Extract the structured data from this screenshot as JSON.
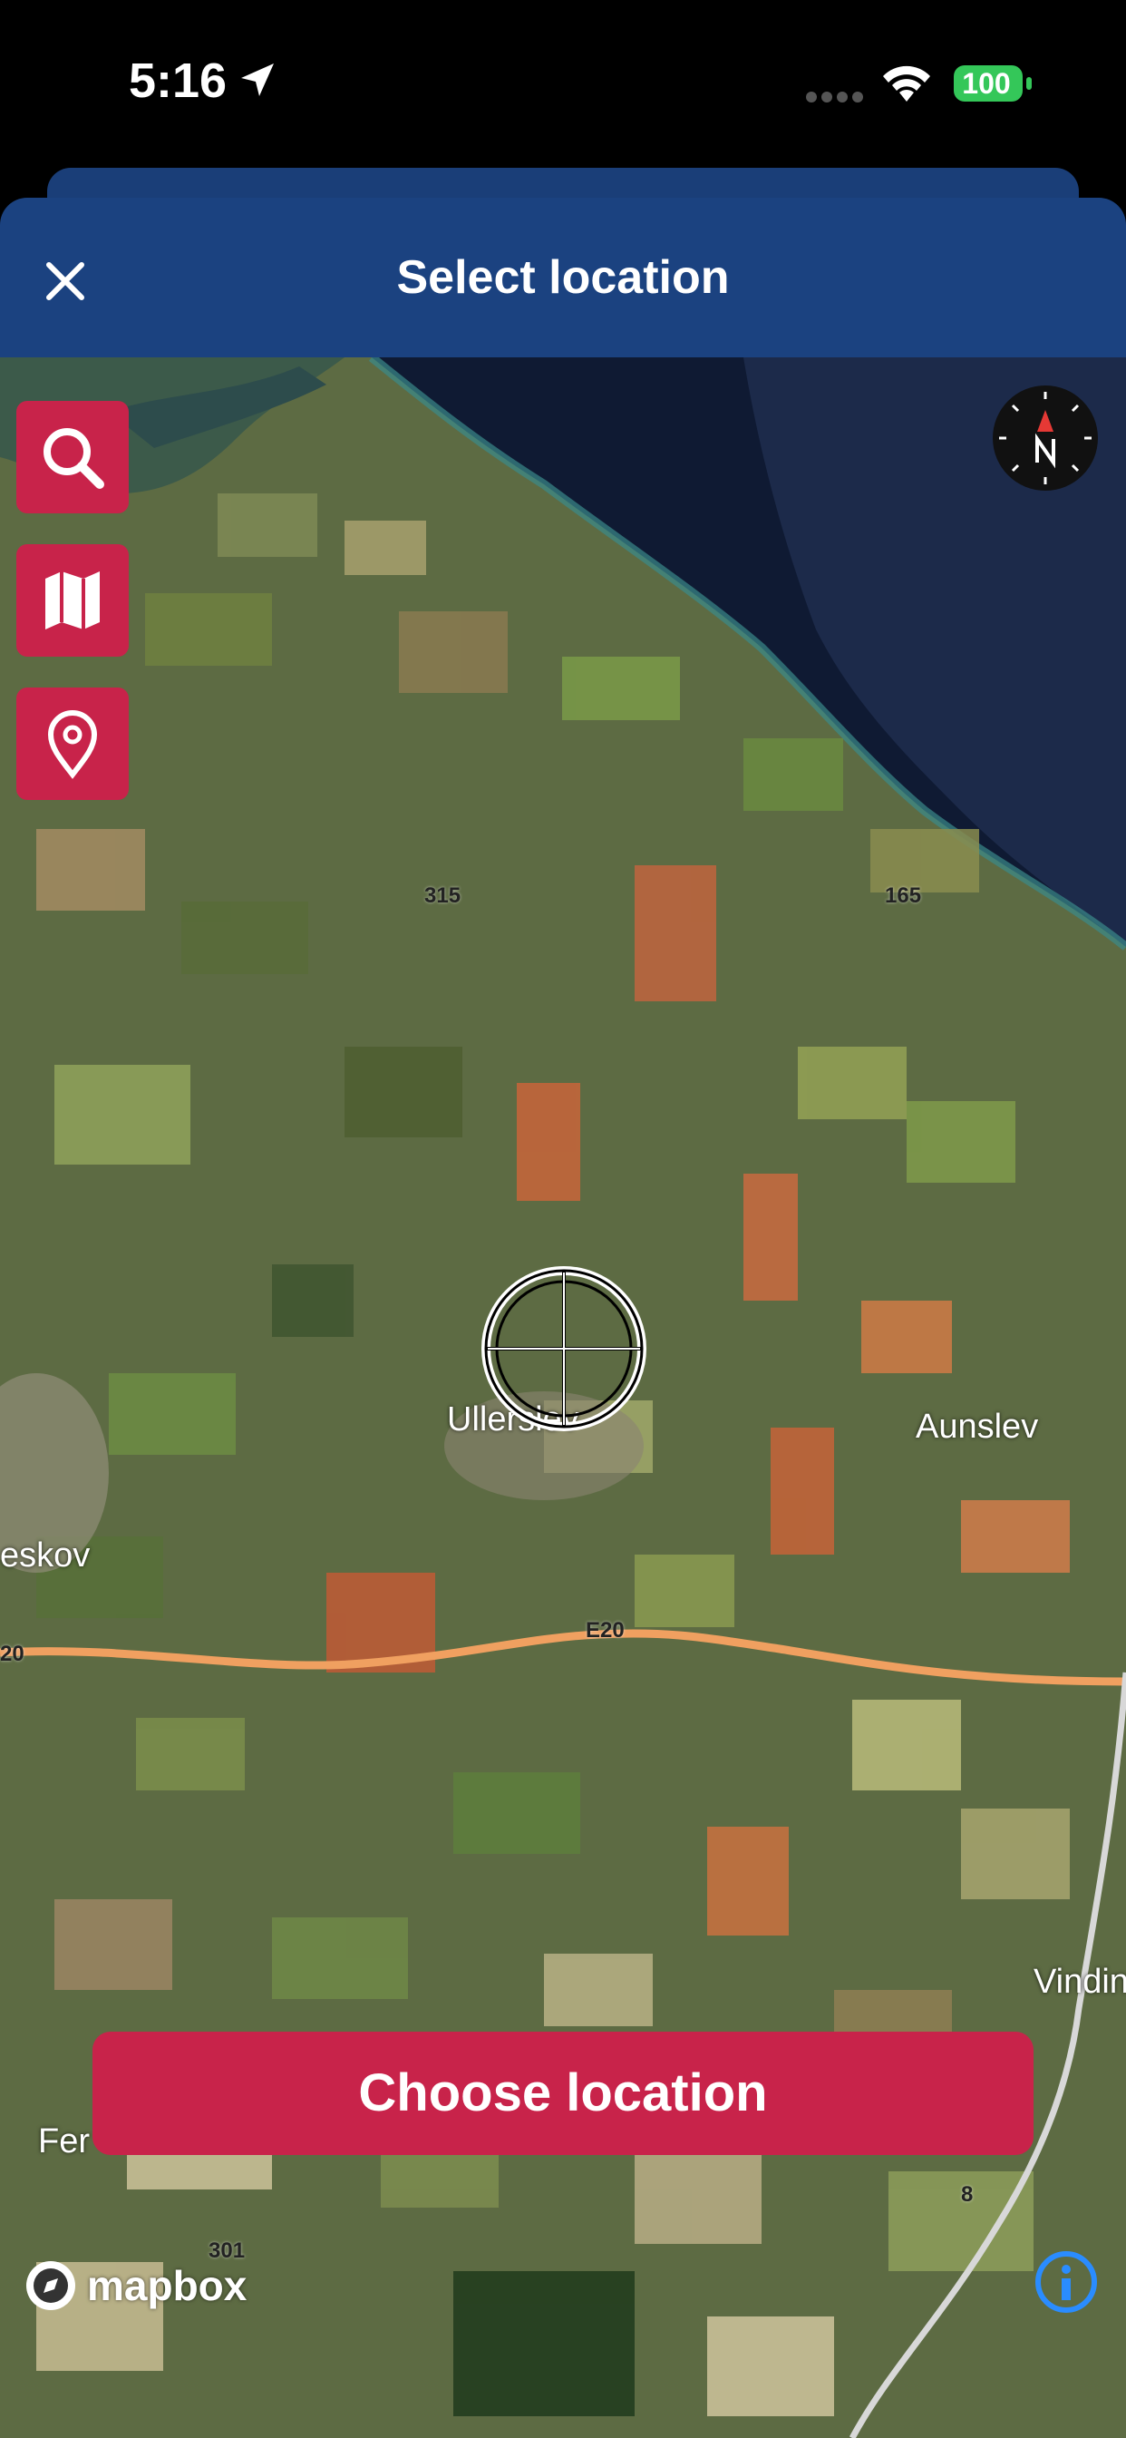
{
  "status_bar": {
    "time": "5:16",
    "battery": "100"
  },
  "header": {
    "title": "Select location"
  },
  "map": {
    "labels": {
      "town_center": "Ullerslev",
      "town_right": "Aunslev",
      "town_left": "eskov",
      "town_right_bottom": "Vindin",
      "town_bottom_left": "Fer"
    },
    "road_numbers": {
      "r315": "315",
      "r165": "165",
      "e20_left": "20",
      "e20": "E20",
      "r8": "8",
      "r301": "301"
    }
  },
  "choose_button": {
    "label": "Choose location"
  },
  "attribution": {
    "brand": "mapbox"
  },
  "colors": {
    "header": "#1b4280",
    "accent": "#c8234a",
    "road": "#f0a060"
  }
}
